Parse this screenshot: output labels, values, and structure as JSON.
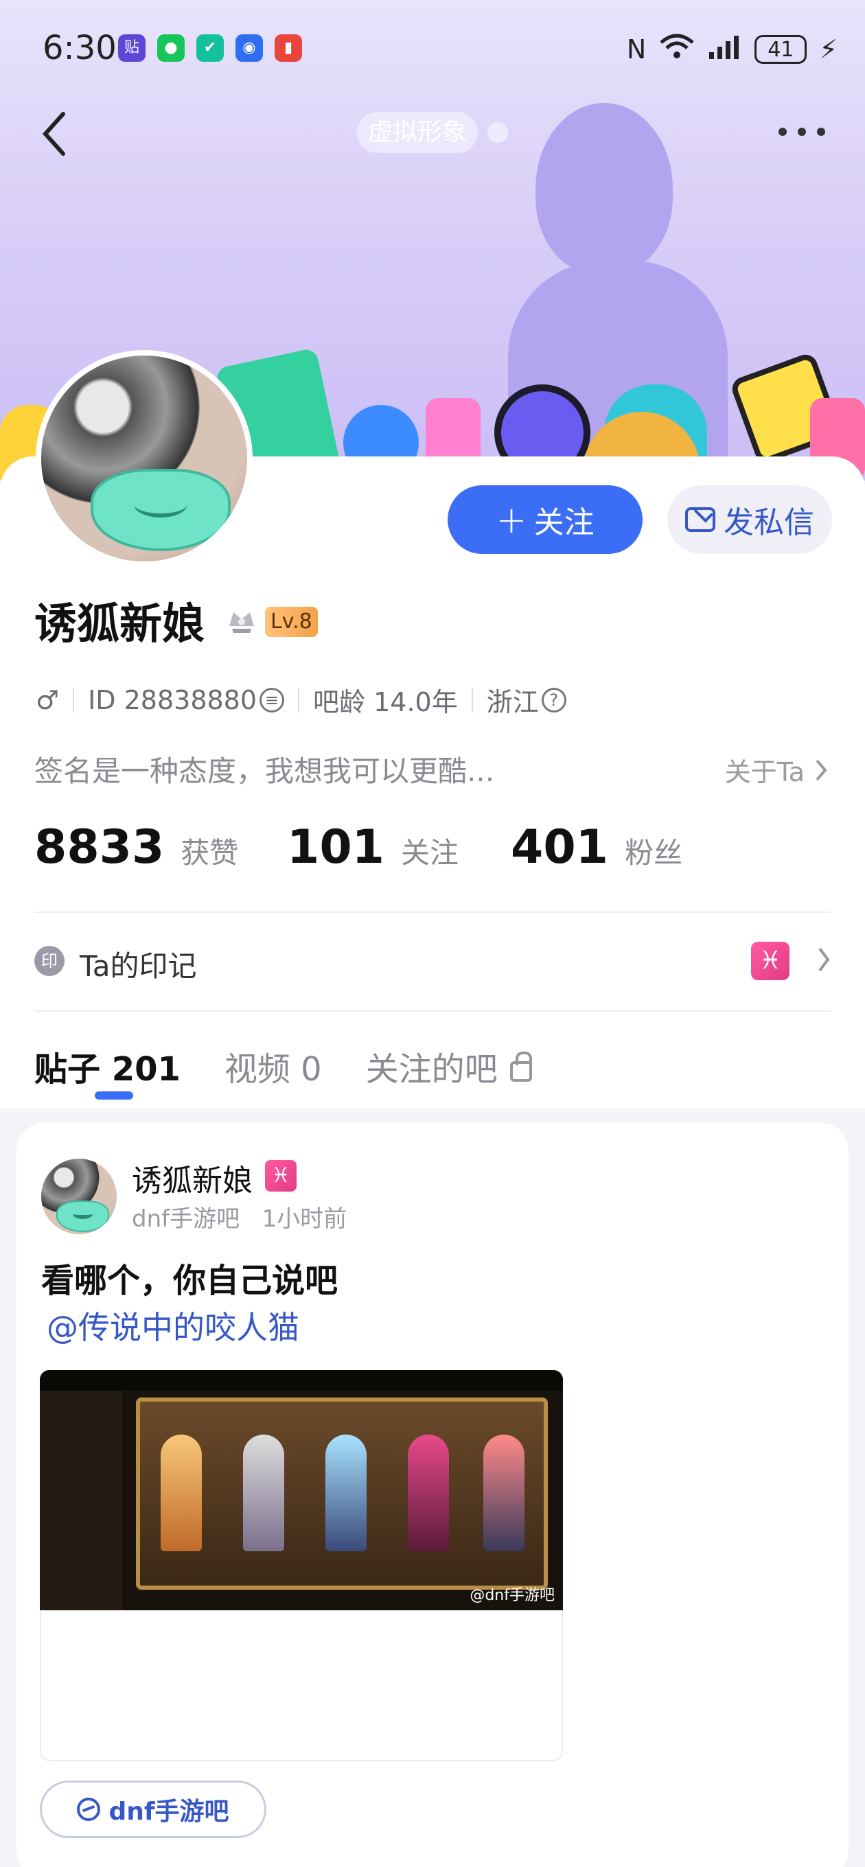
{
  "status_bar": {
    "time": "6:30",
    "app_icons": [
      {
        "name": "tieba-icon",
        "glyph": "贴",
        "color": "#5b48d6"
      },
      {
        "name": "wechat-icon",
        "glyph": "●",
        "color": "#17c55b"
      },
      {
        "name": "security-icon",
        "glyph": "✔",
        "color": "#13c29a"
      },
      {
        "name": "shield-app-icon",
        "glyph": "◉",
        "color": "#2f6ef0"
      },
      {
        "name": "reader-icon",
        "glyph": "▮",
        "color": "#e8453c"
      }
    ],
    "nfc": "N",
    "wifi": "6",
    "battery": "41"
  },
  "header": {
    "avatar_tag": "虚拟形象"
  },
  "profile": {
    "name": "诱狐新娘",
    "level": "Lv.8",
    "gender": "♂",
    "id_label": "ID 28838880",
    "age_label": "吧龄 14.0年",
    "location": "浙江",
    "signature": "签名是一种态度，我想我可以更酷...",
    "about_label": "关于Ta",
    "follow_button": "关注",
    "message_button": "发私信"
  },
  "stats": [
    {
      "value": "8833",
      "label": "获赞"
    },
    {
      "value": "101",
      "label": "关注"
    },
    {
      "value": "401",
      "label": "粉丝"
    }
  ],
  "marks": {
    "icon_glyph": "印",
    "label": "Ta的印记",
    "zodiac_glyph": "♓"
  },
  "tabs": [
    {
      "label": "贴子 201",
      "active": true
    },
    {
      "label": "视频 0",
      "active": false
    },
    {
      "label": "关注的吧",
      "active": false
    }
  ],
  "post": {
    "author": "诱狐新娘",
    "author_badge": "♓",
    "forum": "dnf手游吧",
    "time": "1小时前",
    "title": "看哪个，你自己说吧",
    "mention": "@传说中的咬人猫",
    "image_watermark": "@dnf手游吧",
    "forum_pill": "dnf手游吧"
  },
  "colors": {
    "accent": "#3c6ef5",
    "link": "#3658c7"
  }
}
